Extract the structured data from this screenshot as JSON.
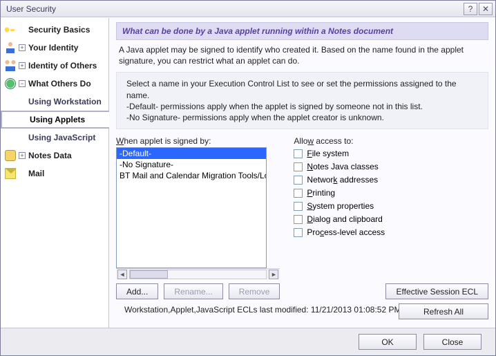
{
  "window": {
    "title": "User Security",
    "help_symbol": "?",
    "close_symbol": "✕"
  },
  "sidebar": {
    "items": [
      {
        "label": "Security Basics",
        "expandable": false
      },
      {
        "label": "Your Identity",
        "expandable": true,
        "expander": "+"
      },
      {
        "label": "Identity of Others",
        "expandable": true,
        "expander": "+"
      },
      {
        "label": "What Others Do",
        "expandable": true,
        "expander": "−",
        "children": [
          {
            "label": "Using Workstation"
          },
          {
            "label": "Using Applets",
            "selected": true
          },
          {
            "label": "Using JavaScript"
          }
        ]
      },
      {
        "label": "Notes Data",
        "expandable": true,
        "expander": "+"
      },
      {
        "label": "Mail",
        "expandable": false
      }
    ]
  },
  "content": {
    "heading": "What can be done by a Java applet running within a Notes document",
    "description": "A Java applet may be signed to identify who created it.  Based on the name found in the applet signature, you can restrict what an applet can do.",
    "info_line1": "Select a name in your Execution Control List to see or set the permissions assigned to the name.",
    "info_line2": "-Default- permissions apply when the applet is signed by someone not in this list.",
    "info_line3": "-No Signature- permissions apply when the applet creator is unknown.",
    "list_label": "When applet is signed by:",
    "list_label_u": "W",
    "signers": [
      "-Default-",
      "-No Signature-",
      "BT Mail and Calendar Migration Tools/Lotus No"
    ],
    "allow_label": "Allow access to:",
    "allow_label_u": "w",
    "permissions": [
      {
        "text": "File system",
        "u": "F"
      },
      {
        "text": "Notes Java classes",
        "u": "N"
      },
      {
        "text": "Network addresses",
        "u": "k"
      },
      {
        "text": "Printing",
        "u": "P"
      },
      {
        "text": "System properties",
        "u": "S"
      },
      {
        "text": "Dialog and clipboard",
        "u": "D"
      },
      {
        "text": "Process-level access",
        "u": "c"
      }
    ],
    "buttons": {
      "add": "Add...",
      "rename": "Rename...",
      "remove": "Remove",
      "effective": "Effective Session ECL",
      "refresh": "Refresh All"
    },
    "status_prefix": "Workstation,Applet,JavaScript ECLs last modified:  ",
    "status_time": "11/21/2013 01:08:52 PM"
  },
  "footer": {
    "ok": "OK",
    "close": "Close"
  }
}
